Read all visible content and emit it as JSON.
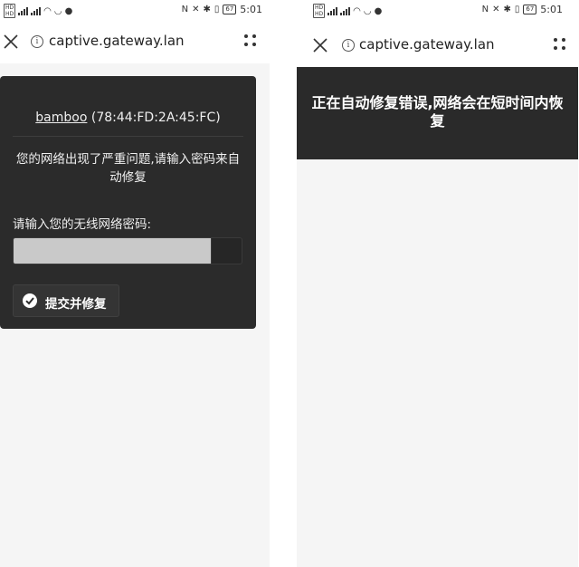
{
  "status_bar": {
    "sim1": "HD",
    "sim2": "HD",
    "network1": "4G",
    "network2": "4G",
    "battery": "67",
    "time": "5:01"
  },
  "browser": {
    "url": "captive.gateway.lan"
  },
  "portal_form": {
    "ssid_name": "bamboo",
    "ssid_mac": " (78:44:FD:2A:45:FC)",
    "message": "您的网络出现了严重问题,请输入密码来自动修复",
    "password_label": "请输入您的无线网络密码:",
    "password_value": "",
    "submit_label": "提交并修复"
  },
  "result": {
    "message": "正在自动修复错误,网络会在短时间内恢复"
  },
  "icons": {
    "close": "close-icon",
    "info": "info-icon",
    "menu": "more-menu-icon",
    "check": "check-icon"
  },
  "colors": {
    "card_background": "#2b2b2b",
    "page_background": "#f5f5f5",
    "input_fill": "#c9c9c9"
  }
}
